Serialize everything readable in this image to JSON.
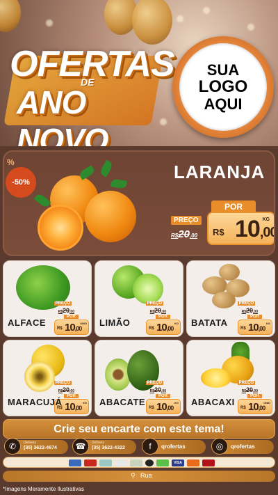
{
  "header": {
    "title_line1": "OFERTAS",
    "title_de": "DE",
    "title_line2": "ANO NOVO",
    "logo_lines": [
      "SUA",
      "LOGO",
      "AQUI"
    ]
  },
  "featured": {
    "name": "LARANJA",
    "discount": "-50%",
    "discount_icon": "%",
    "preco_label": "PREÇO",
    "old_currency": "R$",
    "old_price_int": "20",
    "old_price_cents": ",00",
    "por_label": "POR",
    "currency": "R$",
    "price_int": "10",
    "price_cents": ",00",
    "unit": "KG"
  },
  "products": [
    {
      "name": "ALFACE",
      "preco_label": "PREÇO",
      "old_currency": "R$",
      "old_int": "20",
      "old_cents": ",00",
      "por_label": "POR",
      "currency": "R$",
      "price_int": "10",
      "price_cents": ",00",
      "unit": "UNID"
    },
    {
      "name": "LIMÃO",
      "preco_label": "PREÇO",
      "old_currency": "R$",
      "old_int": "20",
      "old_cents": ",00",
      "por_label": "POR",
      "currency": "R$",
      "price_int": "10",
      "price_cents": ",00",
      "unit": "KG"
    },
    {
      "name": "BATATA",
      "preco_label": "PREÇO",
      "old_currency": "R$",
      "old_int": "20",
      "old_cents": ",00",
      "por_label": "POR",
      "currency": "R$",
      "price_int": "10",
      "price_cents": ",00",
      "unit": "KG"
    },
    {
      "name": "MARACUJÁ",
      "preco_label": "PREÇO",
      "old_currency": "R$",
      "old_int": "20",
      "old_cents": ",00",
      "por_label": "POR",
      "currency": "R$",
      "price_int": "10",
      "price_cents": ",00",
      "unit": "KG"
    },
    {
      "name": "ABACATE",
      "preco_label": "PREÇO",
      "old_currency": "R$",
      "old_int": "20",
      "old_cents": ",00",
      "por_label": "POR",
      "currency": "R$",
      "price_int": "10",
      "price_cents": ",00",
      "unit": "KG"
    },
    {
      "name": "ABACAXI",
      "preco_label": "PREÇO",
      "old_currency": "R$",
      "old_int": "20",
      "old_cents": ",00",
      "por_label": "POR",
      "currency": "R$",
      "price_int": "10",
      "price_cents": ",00",
      "unit": "UNID"
    }
  ],
  "cta": "Crie seu encarte com este tema!",
  "contacts": [
    {
      "icon": "whatsapp-icon",
      "label": "Delivery",
      "text": "(35) 3622-4674"
    },
    {
      "icon": "phone-icon",
      "label": "Delivery",
      "text": "(35) 3622-4322"
    },
    {
      "icon": "facebook-icon",
      "label": "",
      "text": "qrofertas"
    },
    {
      "icon": "instagram-icon",
      "label": "",
      "text": "qrofertas"
    }
  ],
  "payments": [
    "pix",
    "boleto",
    "dinheiro",
    "cartao",
    "vale",
    "elo",
    "alelo",
    "ticket",
    "VISA",
    "mastercard",
    "hipercard"
  ],
  "address": "Rua",
  "footnote": "*Imagens Meramente Ilustrativas",
  "colors": {
    "accent": "#e88d2a",
    "brown": "#6e4434",
    "price_bg": "#fcd79a"
  }
}
